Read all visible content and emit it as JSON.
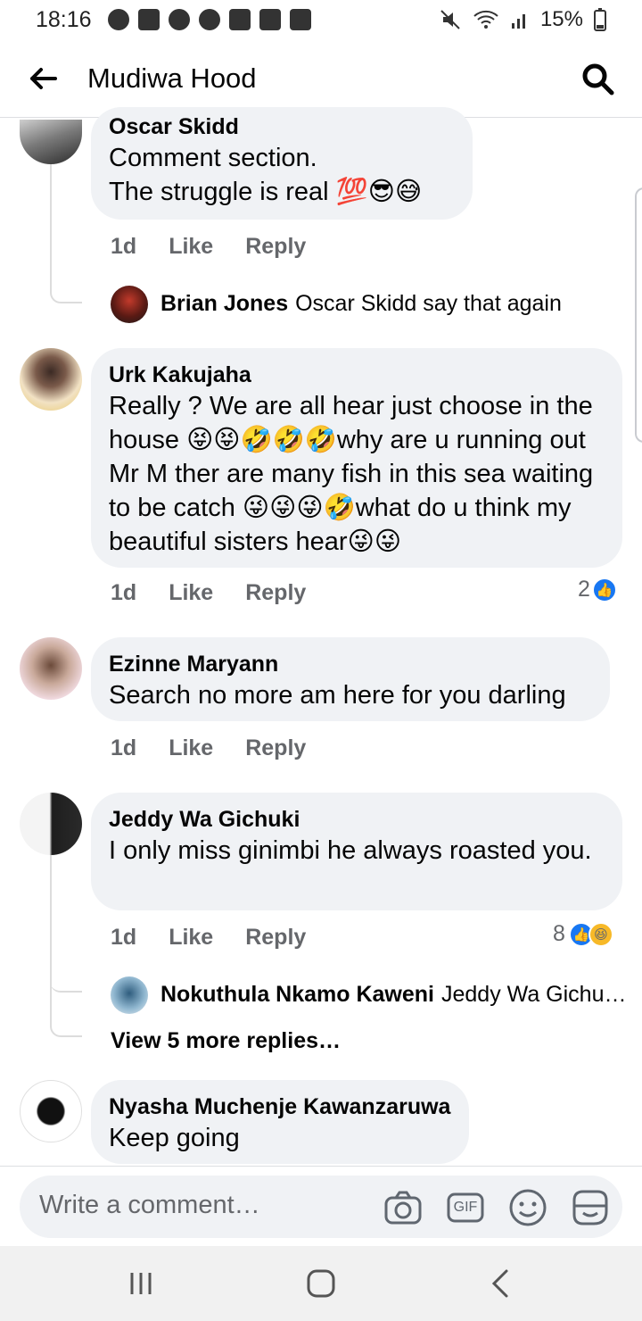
{
  "status_bar": {
    "time": "18:16",
    "battery": "15%"
  },
  "header": {
    "title": "Mudiwa Hood"
  },
  "comments": [
    {
      "author": "Oscar Skidd",
      "text": "Comment section.\nThe struggle is real 💯😎😅",
      "time": "1d",
      "like": "Like",
      "reply": "Reply"
    },
    {
      "author": "Urk Kakujaha",
      "text": "Really ? We are all hear just choose in the house 😝😝🤣🤣🤣why are u running out Mr M ther are many fish in this sea waiting to be catch 😜😜😜🤣what do u think my beautiful sisters hear😜😜",
      "time": "1d",
      "like": "Like",
      "reply": "Reply",
      "reactions": "2"
    },
    {
      "author": "Ezinne Maryann",
      "text": "Search no more am here for you darling",
      "time": "1d",
      "like": "Like",
      "reply": "Reply"
    },
    {
      "author": "Jeddy Wa Gichuki",
      "text": "I only miss ginimbi he always roasted you.",
      "time": "1d",
      "like": "Like",
      "reply": "Reply",
      "reactions": "8"
    },
    {
      "author": "Nyasha Muchenje Kawanzaruwa",
      "text": "Keep going"
    }
  ],
  "replies": [
    {
      "author": "Brian Jones",
      "text": "Oscar Skidd say that again"
    },
    {
      "author": "Nokuthula Nkamo Kaweni",
      "text": "Jeddy Wa Gichu…"
    }
  ],
  "view_more": "View 5 more replies…",
  "composer": {
    "placeholder": "Write a comment…",
    "gif_label": "GIF"
  },
  "colors": {
    "link_blue": "#1877f2",
    "bubble": "#f0f2f5",
    "meta_gray": "#65676b"
  }
}
